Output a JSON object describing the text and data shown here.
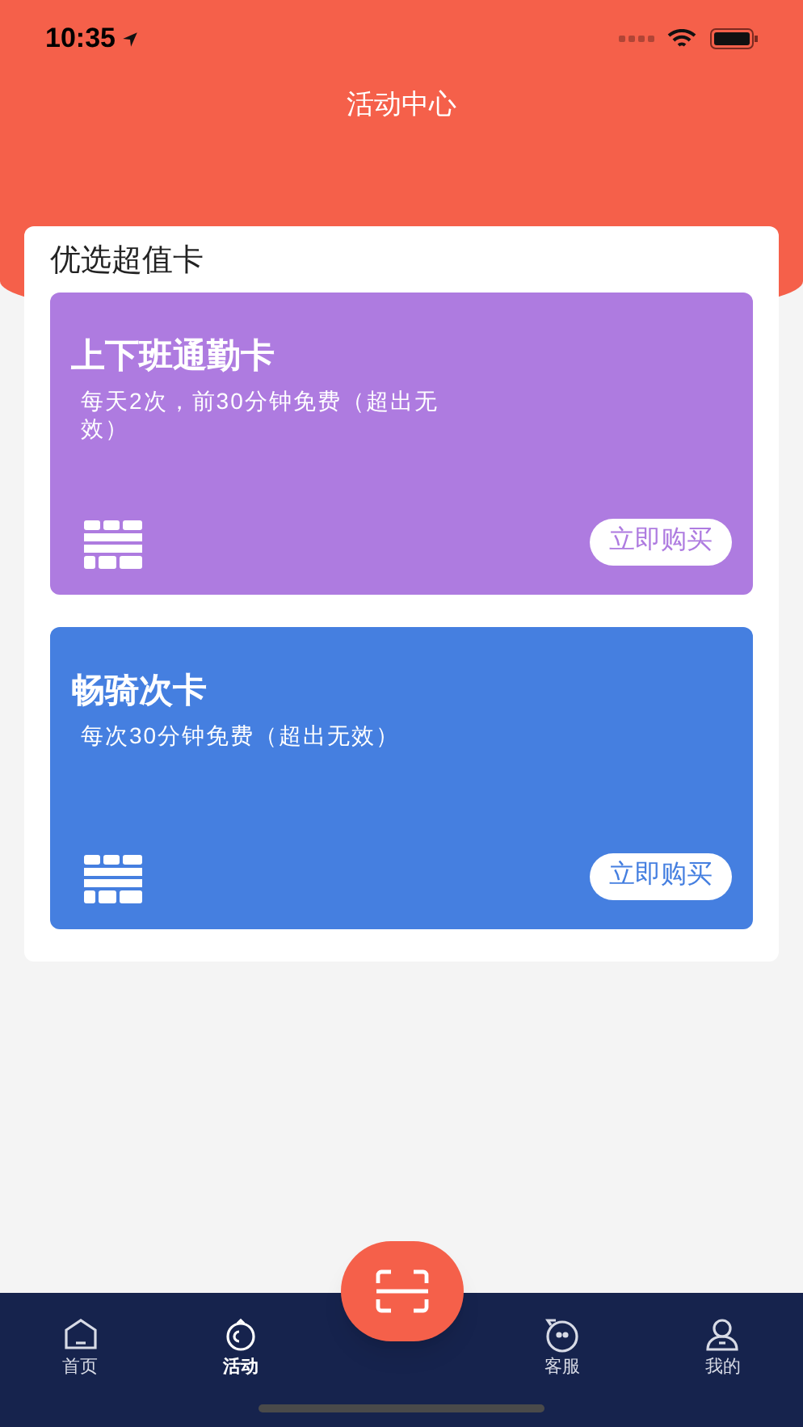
{
  "status_bar": {
    "time": "10:35"
  },
  "header": {
    "title": "活动中心"
  },
  "section": {
    "title": "优选超值卡"
  },
  "cards": [
    {
      "title": "上下班通勤卡",
      "description": "每天2次，前30分钟免费（超出无效）",
      "button": "立即购买",
      "color": "#ae7be0"
    },
    {
      "title": "畅骑次卡",
      "description": "每次30分钟免费（超出无效）",
      "button": "立即购买",
      "color": "#457fe0"
    }
  ],
  "tabs": [
    {
      "label": "首页",
      "kind": "home",
      "selected": false
    },
    {
      "label": "活动",
      "kind": "activity",
      "selected": true
    },
    {
      "kind": "scan",
      "selected": false
    },
    {
      "label": "客服",
      "kind": "service",
      "selected": false
    },
    {
      "label": "我的",
      "kind": "profile",
      "selected": false
    }
  ]
}
